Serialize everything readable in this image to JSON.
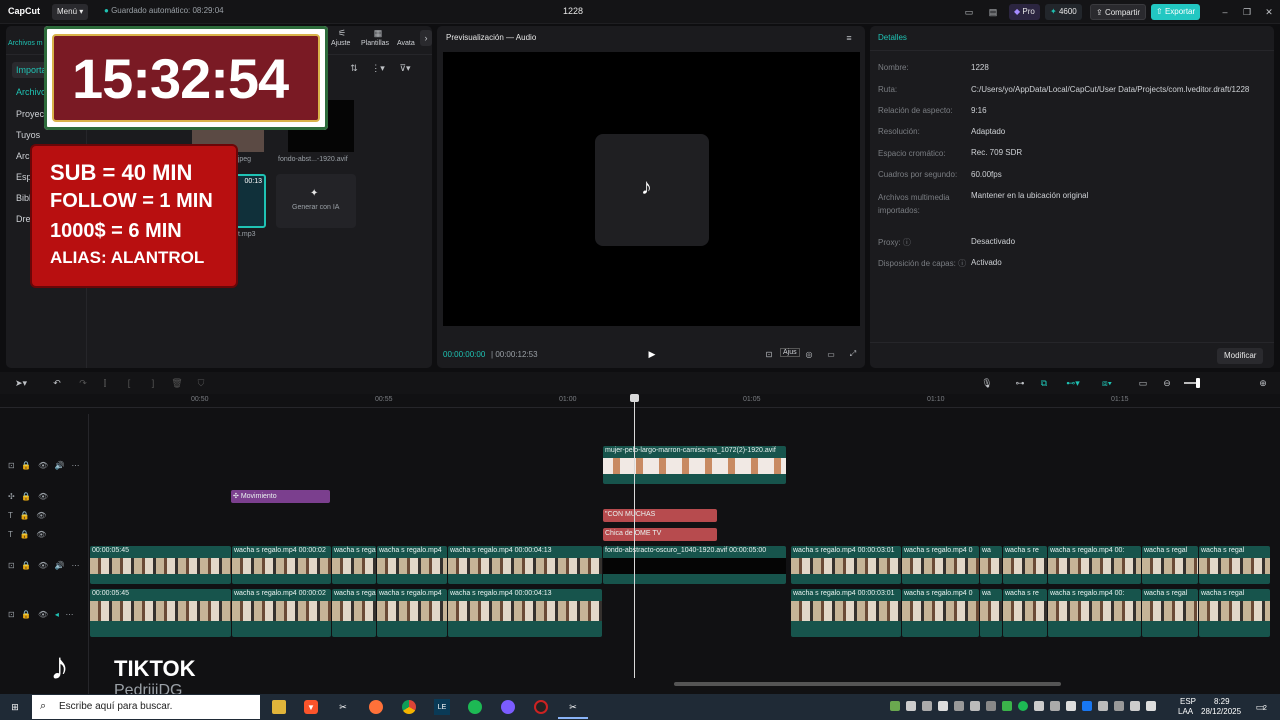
{
  "app": {
    "name": "CapCut",
    "menu": "Menú",
    "autosave": "Guardado automático: 08:29:04",
    "project_title": "1228",
    "pro": "Pro",
    "credits": "4600",
    "share": "Compartir",
    "export": "Exportar"
  },
  "left_panel": {
    "tabs": [
      "Archivos m",
      "Ajuste",
      "Plantillas",
      "Avata"
    ],
    "side_items": [
      "Importa",
      "Archivo",
      "Proyect",
      "Tuyos",
      "Archi",
      "Esp",
      "Bibli",
      "Dre"
    ],
    "media": [
      {
        "name": "n.jpeg"
      },
      {
        "name": "fondo-abst...-1920.avif"
      },
      {
        "name": "t.mp3",
        "duration": "00:13"
      }
    ],
    "generate_ai": "Generar con IA"
  },
  "overlay": {
    "clock": "15:32:54",
    "rules": [
      "SUB = 40 MIN",
      "FOLLOW = 1 MIN",
      "1000$ = 6 MIN",
      "ALIAS: ALANTROL"
    ],
    "tiktok": "TIKTOK",
    "tiktok_user": "PedriiiDG"
  },
  "preview": {
    "title": "Previsualización — Audio",
    "current_time": "00:00:00:00",
    "total_time": "00:00:12:53",
    "ratio_btn": "Ajus"
  },
  "details": {
    "title": "Detalles",
    "rows": [
      {
        "label": "Nombre:",
        "value": "1228"
      },
      {
        "label": "Ruta:",
        "value": "C:/Users/yo/AppData/Local/CapCut/User Data/Projects/com.lveditor.draft/1228"
      },
      {
        "label": "Relación de aspecto:",
        "value": "9:16"
      },
      {
        "label": "Resolución:",
        "value": "Adaptado"
      },
      {
        "label": "Espacio cromático:",
        "value": "Rec. 709 SDR"
      },
      {
        "label": "Cuadros por segundo:",
        "value": "60.00fps"
      },
      {
        "label": "Archivos multimedia importados:",
        "value": "Mantener en la ubicación original"
      },
      {
        "label": "Proxy:",
        "value": "Desactivado"
      },
      {
        "label": "Disposición de capas:",
        "value": "Activado"
      }
    ],
    "modify": "Modificar"
  },
  "timeline": {
    "ruler": [
      "00:50",
      "00:55",
      "01:00",
      "01:05",
      "01:10",
      "01:15"
    ],
    "overlay_clip": "mujer-pelo-largo-marron-camisa-ma_1072(2)-1920.avif",
    "effect_clip": "Movimiento",
    "text_clips": [
      "\"CON MUCHAS",
      "Chica de OME TV"
    ],
    "main_clips": [
      {
        "label": "00:00:05:45"
      },
      {
        "label": "wacha s regalo.mp4  00:00:02"
      },
      {
        "label": "wacha s rega"
      },
      {
        "label": "wacha s regalo.mp4"
      },
      {
        "label": "wacha s regalo.mp4  00:00:04:13"
      },
      {
        "label": "fondo-abstracto-oscuro_1040-1920.avif  00:00:05:00"
      },
      {
        "label": "wacha s regalo.mp4  00:00:03:01"
      },
      {
        "label": "wacha s regalo.mp4  0"
      },
      {
        "label": "wa"
      },
      {
        "label": "wacha s re"
      },
      {
        "label": "wacha s regalo.mp4  00:"
      },
      {
        "label": "wacha s regal"
      },
      {
        "label": "wacha s regal"
      }
    ],
    "second_clips": [
      {
        "label": "00:00:05:45"
      },
      {
        "label": "wacha s regalo.mp4  00:00:02"
      },
      {
        "label": "wacha s rega"
      },
      {
        "label": "wacha s regalo.mp4"
      },
      {
        "label": "wacha s regalo.mp4  00:00:04:13"
      },
      {
        "label": "wacha s regalo.mp4  00:00:03:01"
      },
      {
        "label": "wacha s regalo.mp4  0"
      },
      {
        "label": "wa"
      },
      {
        "label": "wacha s re"
      },
      {
        "label": "wacha s regalo.mp4  00:"
      },
      {
        "label": "wacha s regal"
      },
      {
        "label": "wacha s regal"
      }
    ]
  },
  "taskbar": {
    "search_placeholder": "Escribe aquí para buscar.",
    "lang": "ESP",
    "lang2": "LAA",
    "time": "8:29",
    "date": "28/12/2025",
    "notif_count": "2"
  }
}
